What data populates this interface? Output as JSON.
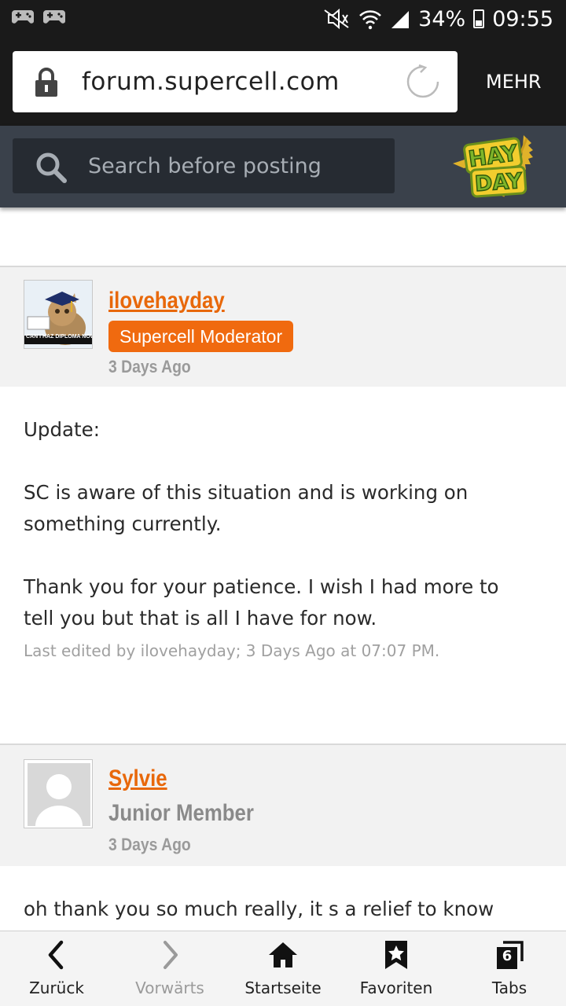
{
  "status_bar": {
    "battery": "34%",
    "time": "09:55",
    "icons": [
      "game-controller-icon",
      "game-controller-icon",
      "mute-icon",
      "wifi-icon",
      "signal-icon",
      "battery-icon"
    ]
  },
  "browser": {
    "url": "forum.supercell.com",
    "menu_label": "MEHR"
  },
  "site": {
    "search_placeholder": "Search before posting",
    "logo_alt": "Hay Day"
  },
  "posts": [
    {
      "username": "ilovehayday",
      "badge": "Supercell Moderator",
      "time": "3 Days Ago",
      "avatar_caption": "CAN I HAZ DIPLOMA NOW?",
      "body": [
        "Update:",
        "SC is aware of this situation and is working on something currently.",
        "Thank you for your patience. I wish I had more to tell you but that is all I have for now."
      ],
      "edited": "Last edited by ilovehayday; 3 Days Ago at 07:07 PM."
    },
    {
      "username": "Sylvie",
      "rank": "Junior Member",
      "time": "3 Days Ago",
      "body": [
        "oh thank you so much really, it s a relief to know"
      ]
    }
  ],
  "bottom_nav": [
    {
      "label": "Zurück",
      "icon": "back-arrow-icon",
      "enabled": true
    },
    {
      "label": "Vorwärts",
      "icon": "forward-arrow-icon",
      "enabled": false
    },
    {
      "label": "Startseite",
      "icon": "home-icon",
      "enabled": true
    },
    {
      "label": "Favoriten",
      "icon": "bookmark-star-icon",
      "enabled": true
    },
    {
      "label": "Tabs",
      "icon": "tabs-icon",
      "enabled": true,
      "count": "6"
    }
  ],
  "colors": {
    "accent": "#e8680a",
    "badge": "#f06a0f",
    "header": "#3a414b",
    "browser_chrome": "#1a1a1a"
  }
}
